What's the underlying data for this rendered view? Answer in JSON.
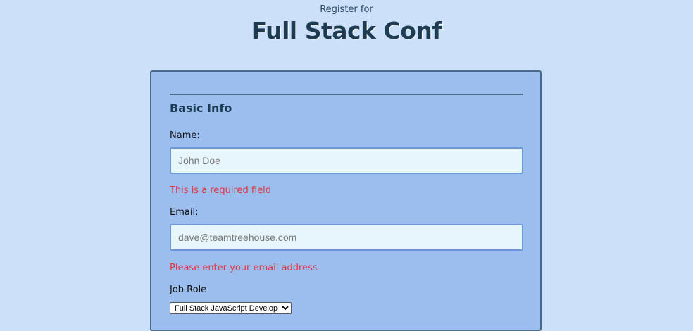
{
  "header": {
    "subtitle": "Register for",
    "title": "Full Stack Conf"
  },
  "form": {
    "section_title": "Basic Info",
    "name": {
      "label": "Name:",
      "placeholder": "John Doe",
      "error": "This is a required field"
    },
    "email": {
      "label": "Email:",
      "placeholder": "dave@teamtreehouse.com",
      "error": "Please enter your email address"
    },
    "job_role": {
      "label": "Job Role",
      "selected": "Full Stack JavaScript Developer"
    }
  },
  "colors": {
    "background": "#cce0fa",
    "panel": "#9bbeee",
    "error": "#e4323f",
    "title": "#1d3b53"
  }
}
